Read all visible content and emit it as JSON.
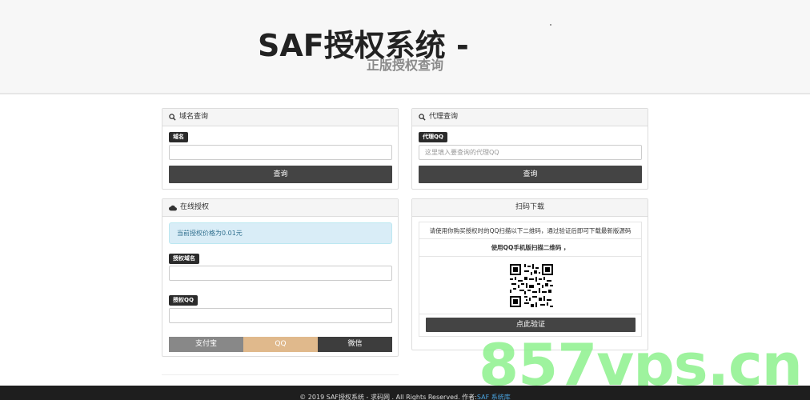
{
  "header": {
    "title": "SAF授权系统 -",
    "subtitle": "正版授权查询"
  },
  "domain_query": {
    "heading": "域名查询",
    "field_label": "域名",
    "field_value": "",
    "button": "查询"
  },
  "agent_query": {
    "heading": "代理查询",
    "field_label": "代理QQ",
    "placeholder": "这里填入要查询的代理QQ",
    "button": "查询"
  },
  "online_auth": {
    "heading": "在线授权",
    "price_notice": "当前授权价格为0.01元",
    "domain_label": "授权域名",
    "qq_label": "授权QQ",
    "pay_buttons": [
      {
        "label": "支付宝",
        "color": "#888888"
      },
      {
        "label": "QQ",
        "color": "#e0b98c"
      },
      {
        "label": "微信",
        "color": "#3d3d3d"
      }
    ]
  },
  "scan_download": {
    "heading": "扫码下载",
    "instruction": "请使用你购买授权时的QQ扫描以下二维码，通过验证后即可下载最新版源码",
    "hint": "使用QQ手机版扫描二维码 ，",
    "verify_button": "点此验证"
  },
  "footer": {
    "text": "© 2019 SAF授权系统 - 求码网 . All Rights Reserved. 作者:",
    "link": "SAF 系统库"
  },
  "watermark": "857vps.cn"
}
